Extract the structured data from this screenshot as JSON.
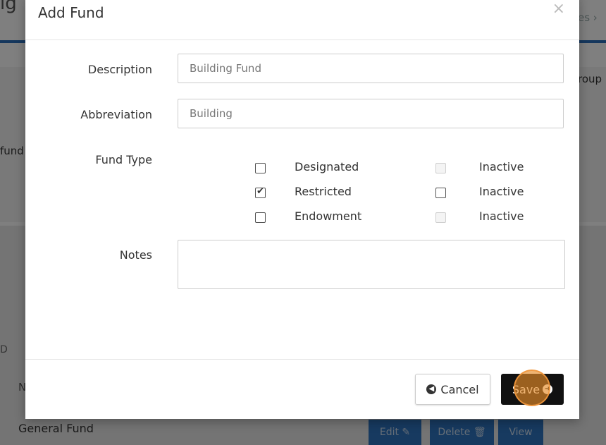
{
  "background": {
    "title_fragment": "ig",
    "breadcrumb_fragment": "es ›",
    "group_fragment": "roup",
    "fund_fragment": "fund",
    "icon_fragment": "D",
    "row_header_fragment": "N",
    "row_name": "General Fund",
    "buttons": {
      "edit_label": "Edit ✎",
      "delete_label": "Delete 🗑",
      "view_label": "View"
    }
  },
  "modal": {
    "title": "Add Fund",
    "close_symbol": "×",
    "fields": {
      "description_label": "Description",
      "description_value": "Building Fund",
      "abbreviation_label": "Abbreviation",
      "abbreviation_value": "Building",
      "fund_type_label": "Fund Type",
      "notes_label": "Notes",
      "notes_value": ""
    },
    "fund_types": [
      {
        "label": "Designated",
        "checked": false,
        "inactive_label": "Inactive",
        "inactive_enabled": false
      },
      {
        "label": "Restricted",
        "checked": true,
        "inactive_label": "Inactive",
        "inactive_enabled": true
      },
      {
        "label": "Endowment",
        "checked": false,
        "inactive_label": "Inactive",
        "inactive_enabled": false
      }
    ],
    "footer": {
      "cancel_label": "Cancel",
      "save_label": "Save"
    }
  },
  "colors": {
    "save_button": "#111111",
    "background_buttons": "#2f74c0",
    "click_indicator": "#e88c28"
  }
}
